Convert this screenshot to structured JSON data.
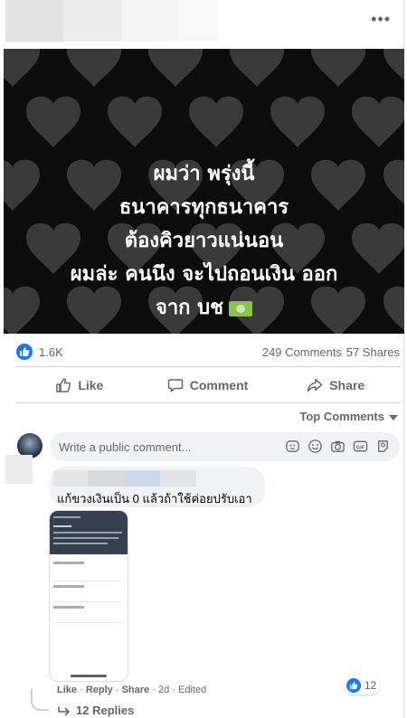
{
  "post": {
    "more_label": "•••",
    "image_text_lines": [
      "ผมว่า พรุ่งนี้",
      "ธนาคารทุกธนาคาร",
      "ต้องคิวยาวแน่นอน",
      "ผมล่ะ คนนึง จะไปถอนเงิน ออก",
      "จาก บช"
    ],
    "money_icon": "money-icon"
  },
  "reactions": {
    "count": "1.6K",
    "comments": "249 Comments",
    "shares": "57 Shares"
  },
  "actions": {
    "like": "Like",
    "comment": "Comment",
    "share": "Share"
  },
  "comments_sort": "Top Comments",
  "composer": {
    "placeholder": "Write a public comment...",
    "icons": [
      "sticker-icon",
      "emoji-icon",
      "camera-icon",
      "gif-icon",
      "avatar-sticker-icon"
    ]
  },
  "comment": {
    "text": "แก้ขวงเงินเป็น 0 แล้วถ้าใช้ค่อยปรับเอา",
    "like_label": "Like",
    "reply_label": "Reply",
    "share_label": "Share",
    "time": "2d",
    "edited": "Edited",
    "likes": "12",
    "replies": "12 Replies"
  },
  "colors": {
    "accent": "#1877f2",
    "image_bg": "#0d0d0d",
    "muted_text": "#65676b"
  }
}
